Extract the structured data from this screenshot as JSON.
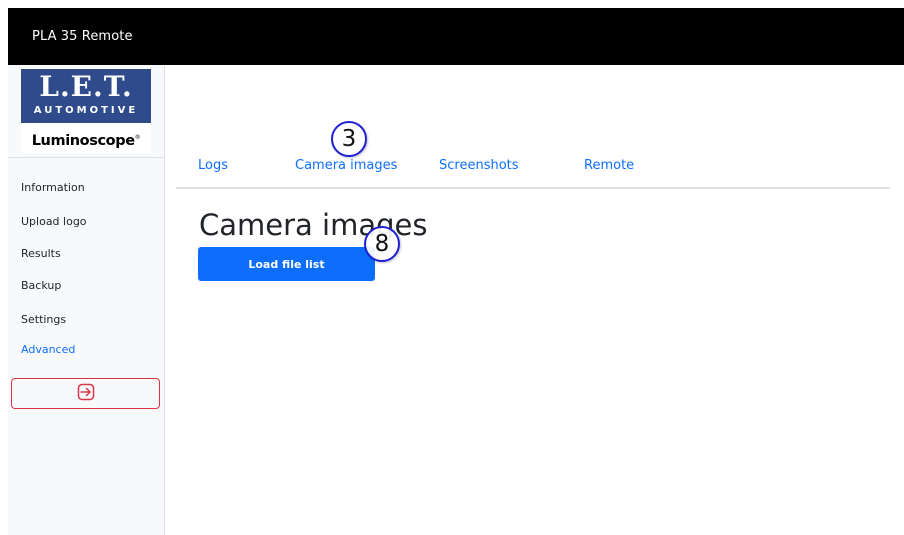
{
  "window": {
    "title": "PLA 35 Remote"
  },
  "logo": {
    "brand_top": "L.E.T.",
    "brand_sub": "AUTOMOTIVE",
    "product": "Luminoscope"
  },
  "sidebar": {
    "items": [
      {
        "label": "Information"
      },
      {
        "label": "Upload logo"
      },
      {
        "label": "Results"
      },
      {
        "label": "Backup"
      },
      {
        "label": "Settings"
      },
      {
        "label": "Advanced",
        "active": true
      }
    ],
    "logout_icon": "logout-icon"
  },
  "tabs": [
    {
      "label": "Logs"
    },
    {
      "label": "Camera images",
      "active": true
    },
    {
      "label": "Screenshots"
    },
    {
      "label": "Remote"
    }
  ],
  "main": {
    "heading": "Camera images",
    "load_button_label": "Load file list"
  },
  "annotations": [
    {
      "label": "3"
    },
    {
      "label": "8"
    }
  ],
  "colors": {
    "accent": "#0d6efd",
    "danger": "#dc3545",
    "titlebar": "#000000",
    "brand": "#2f4b8c",
    "marker_ring": "#1f1fd6"
  }
}
